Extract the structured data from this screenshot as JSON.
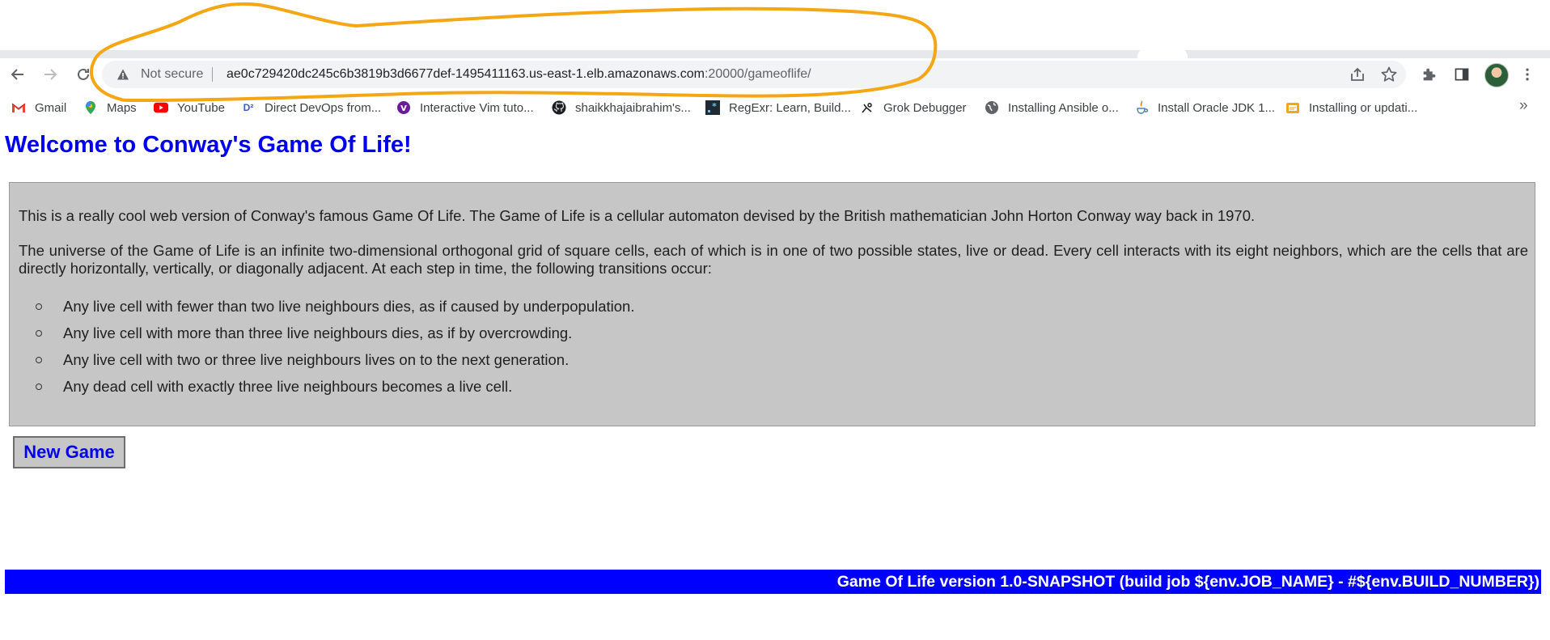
{
  "browser": {
    "omnibox": {
      "security_label": "Not secure",
      "url_host": "ae0c729420dc245c6b3819b3d6677def-1495411163.us-east-1.elb.amazonaws.com",
      "url_rest": ":20000/gameoflife/"
    },
    "bookmarks": [
      {
        "label": "Gmail",
        "icon": "gmail-icon"
      },
      {
        "label": "Maps",
        "icon": "maps-icon"
      },
      {
        "label": "YouTube",
        "icon": "youtube-icon"
      },
      {
        "label": "Direct DevOps from...",
        "icon": "devops-icon"
      },
      {
        "label": "Interactive Vim tuto...",
        "icon": "vim-icon"
      },
      {
        "label": "shaikkhajaibrahim's...",
        "icon": "github-icon"
      },
      {
        "label": "RegExr: Learn, Build...",
        "icon": "regexr-icon"
      },
      {
        "label": "Grok Debugger",
        "icon": "grok-icon"
      },
      {
        "label": "Installing Ansible o...",
        "icon": "globe-icon"
      },
      {
        "label": "Install Oracle JDK 1...",
        "icon": "java-icon"
      },
      {
        "label": "Installing or updati...",
        "icon": "aws-docs-icon"
      }
    ],
    "more_bookmarks": "»"
  },
  "page": {
    "title": "Welcome to Conway's Game Of Life!",
    "intro": "This is a really cool web version of Conway's famous Game Of Life. The Game of Life is a cellular automaton devised by the British mathematician John Horton Conway way back in 1970.",
    "universe": "The universe of the Game of Life is an infinite two-dimensional orthogonal grid of square cells, each of which is in one of two possible states, live or dead. Every cell interacts with its eight neighbors, which are the cells that are directly horizontally, vertically, or diagonally adjacent. At each step in time, the following transitions occur:",
    "rules": [
      "Any live cell with fewer than two live neighbours dies, as if caused by underpopulation.",
      "Any live cell with more than three live neighbours dies, as if by overcrowding.",
      "Any live cell with two or three live neighbours lives on to the next generation.",
      "Any dead cell with exactly three live neighbours becomes a live cell."
    ],
    "new_game_label": "New Game",
    "footer": "Game Of Life version 1.0-SNAPSHOT (build job ${env.JOB_NAME} - #${env.BUILD_NUMBER})"
  },
  "colors": {
    "link_blue": "#0000ee",
    "footer_blue": "#0000ff",
    "panel_gray": "#c6c6c6",
    "annotation_orange": "#f5a614"
  }
}
